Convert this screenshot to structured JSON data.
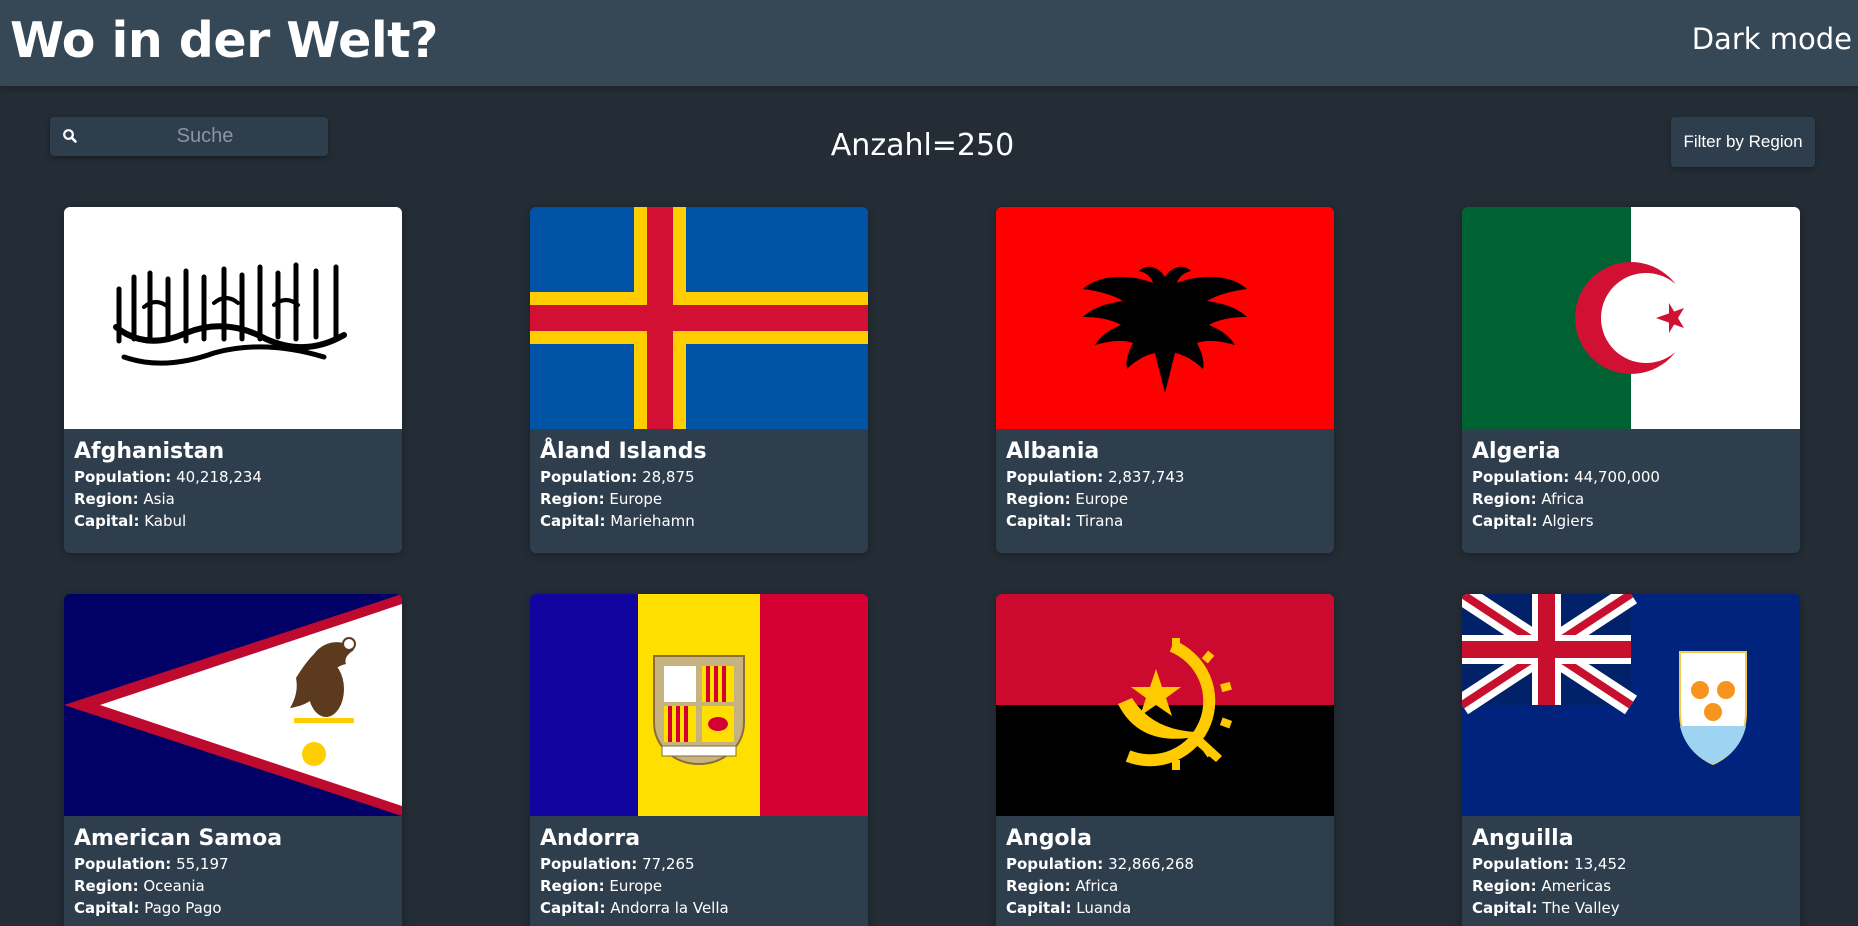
{
  "header": {
    "title": "Wo in der Welt?",
    "dark_mode_label": "Dark mode"
  },
  "search": {
    "placeholder": "Suche",
    "icon": "search-icon"
  },
  "count_text": "Anzahl=250",
  "filter": {
    "label": "Filter by Region"
  },
  "labels": {
    "population": "Population:",
    "region": "Region:",
    "capital": "Capital:"
  },
  "countries": [
    {
      "name": "Afghanistan",
      "population": "40,218,234",
      "region": "Asia",
      "capital": "Kabul"
    },
    {
      "name": "Åland Islands",
      "population": "28,875",
      "region": "Europe",
      "capital": "Mariehamn"
    },
    {
      "name": "Albania",
      "population": "2,837,743",
      "region": "Europe",
      "capital": "Tirana"
    },
    {
      "name": "Algeria",
      "population": "44,700,000",
      "region": "Africa",
      "capital": "Algiers"
    },
    {
      "name": "American Samoa",
      "population": "55,197",
      "region": "Oceania",
      "capital": "Pago Pago"
    },
    {
      "name": "Andorra",
      "population": "77,265",
      "region": "Europe",
      "capital": "Andorra la Vella"
    },
    {
      "name": "Angola",
      "population": "32,866,268",
      "region": "Africa",
      "capital": "Luanda"
    },
    {
      "name": "Anguilla",
      "population": "13,452",
      "region": "Americas",
      "capital": "The Valley"
    }
  ],
  "colors": {
    "background": "#242c35",
    "header": "#364756",
    "card": "#2f3e4d",
    "text": "#ffffff"
  }
}
